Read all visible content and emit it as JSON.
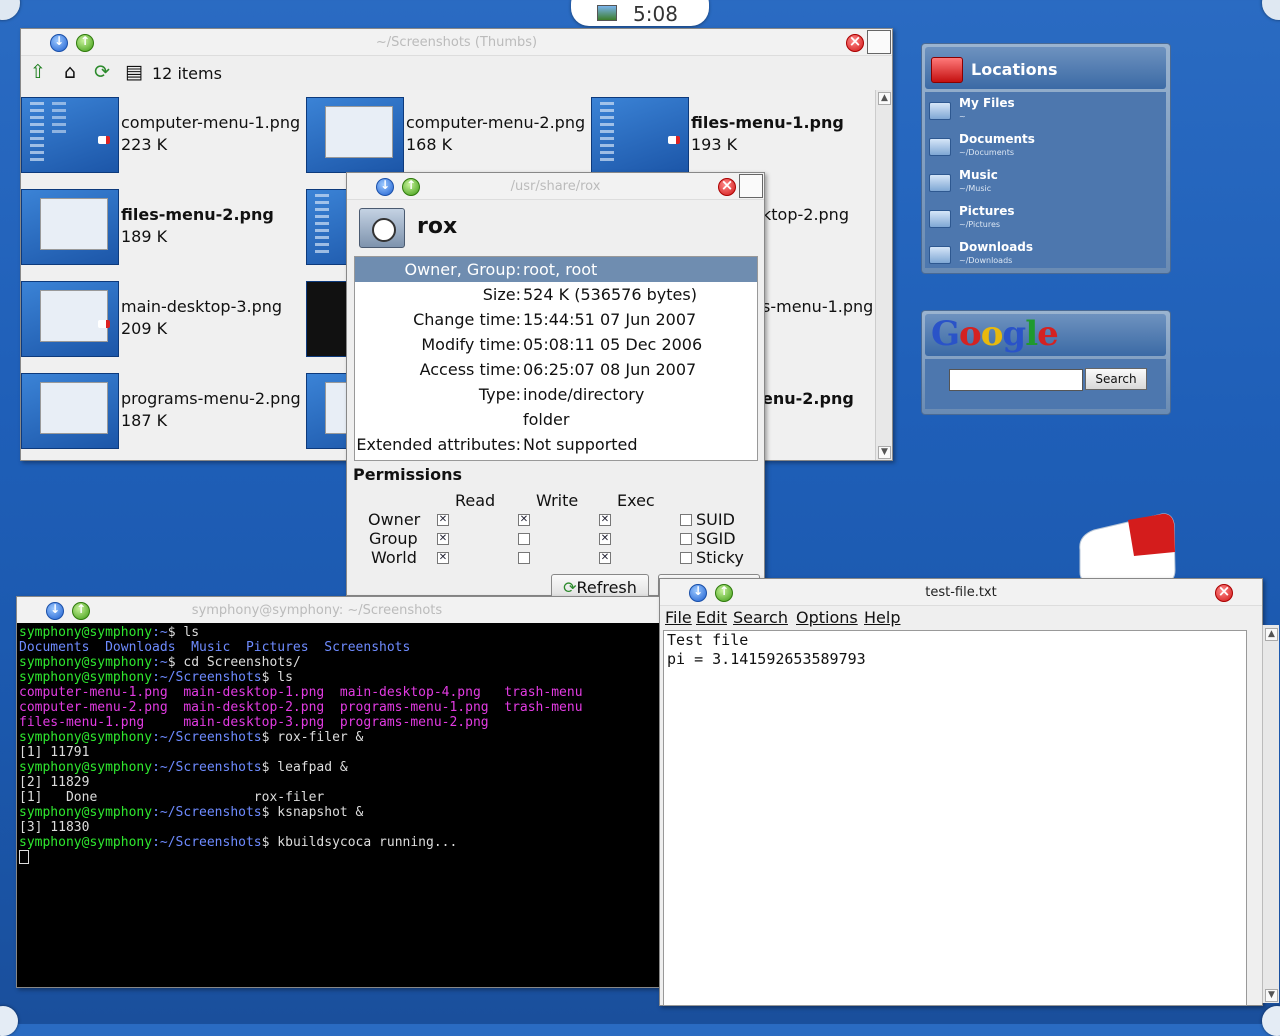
{
  "clock": {
    "time": "5:08"
  },
  "file_manager": {
    "title": "~/Screenshots (Thumbs)",
    "item_count": "12 items",
    "files": [
      {
        "name": "computer-menu-1.png",
        "size": "223  K",
        "bold": false
      },
      {
        "name": "computer-menu-2.png",
        "size": "168  K",
        "bold": false
      },
      {
        "name": "files-menu-1.png",
        "size": "193  K",
        "bold": true
      },
      {
        "name": "files-menu-2.png",
        "size": "189  K",
        "bold": true
      },
      {
        "name": "ktop-2.png",
        "size": "",
        "bold": false
      },
      {
        "name": "main-desktop-3.png",
        "size": "209  K",
        "bold": false
      },
      {
        "name": "s-menu-1.png",
        "size": "",
        "bold": false
      },
      {
        "name": "programs-menu-2.png",
        "size": "187  K",
        "bold": false
      },
      {
        "name": "enu-2.png",
        "size": "",
        "bold": true
      }
    ]
  },
  "properties": {
    "title": "/usr/share/rox",
    "name": "rox",
    "rows": [
      {
        "key": "Owner, Group:",
        "value": "root, root"
      },
      {
        "key": "Size:",
        "value": "524 K (536576 bytes)"
      },
      {
        "key": "Change time:",
        "value": "15:44:51 07 Jun 2007"
      },
      {
        "key": "Modify time:",
        "value": "05:08:11 05 Dec 2006"
      },
      {
        "key": "Access time:",
        "value": "06:25:07 08 Jun 2007"
      },
      {
        "key": "Type:",
        "value": "inode/directory"
      },
      {
        "key": "",
        "value": "folder"
      },
      {
        "key": "Extended attributes:",
        "value": "Not supported"
      }
    ],
    "permissions_label": "Permissions",
    "col_read": "Read",
    "col_write": "Write",
    "col_exec": "Exec",
    "row_owner": "Owner",
    "row_group": "Group",
    "row_world": "World",
    "suid": "SUID",
    "sgid": "SGID",
    "sticky": "Sticky",
    "refresh": "Refresh",
    "perm_matrix": [
      [
        true,
        true,
        true
      ],
      [
        true,
        false,
        true
      ],
      [
        true,
        false,
        true
      ]
    ]
  },
  "locations": {
    "title": "Locations",
    "items": [
      {
        "name": "My Files",
        "path": "~"
      },
      {
        "name": "Documents",
        "path": "~/Documents"
      },
      {
        "name": "Music",
        "path": "~/Music"
      },
      {
        "name": "Pictures",
        "path": "~/Pictures"
      },
      {
        "name": "Downloads",
        "path": "~/Downloads"
      }
    ]
  },
  "google": {
    "search_button": "Search",
    "search_value": "",
    "logo": "Google"
  },
  "terminal": {
    "title": "symphony@symphony: ~/Screenshots",
    "prompt_user": "symphony@symphony",
    "lines": [
      {
        "path": ":~",
        "cmd": "$ ls"
      },
      {
        "dirs": "Documents  Downloads  Music  Pictures  Screenshots"
      },
      {
        "path": ":~",
        "cmd": "$ cd Screenshots/"
      },
      {
        "path": ":~/Screenshots",
        "cmd": "$ ls"
      },
      {
        "files": "computer-menu-1.png  main-desktop-1.png  main-desktop-4.png   trash-menu"
      },
      {
        "files": "computer-menu-2.png  main-desktop-2.png  programs-menu-1.png  trash-menu"
      },
      {
        "files": "files-menu-1.png     main-desktop-3.png  programs-menu-2.png"
      },
      {
        "path": ":~/Screenshots",
        "cmd": "$ rox-filer &"
      },
      {
        "out": "[1] 11791"
      },
      {
        "path": ":~/Screenshots",
        "cmd": "$ leafpad &"
      },
      {
        "out": "[2] 11829"
      },
      {
        "out": "[1]   Done                    rox-filer"
      },
      {
        "path": ":~/Screenshots",
        "cmd": "$ ksnapshot &"
      },
      {
        "out": "[3] 11830"
      },
      {
        "path": ":~/Screenshots",
        "cmd": "$ kbuildsycoca running..."
      }
    ]
  },
  "leafpad": {
    "title": "test-file.txt",
    "menu": [
      "File",
      "Edit",
      "Search",
      "Options",
      "Help"
    ],
    "text_lines": [
      "Test file",
      "pi = 3.141592653589793"
    ]
  }
}
